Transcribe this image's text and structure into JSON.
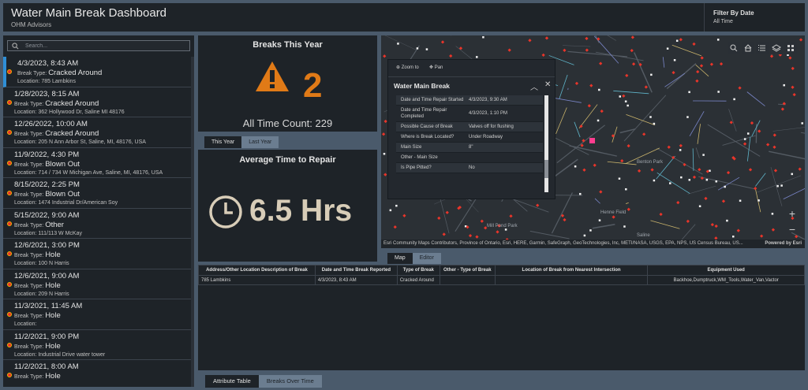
{
  "header": {
    "title": "Water Main Break Dashboard",
    "subtitle": "OHM Advisors",
    "filter_label": "Filter By Date",
    "filter_value": "All Time"
  },
  "search": {
    "placeholder": "Search..."
  },
  "breaks_list": [
    {
      "datetime": "4/3/2023, 8:43 AM",
      "type_label": "Break Type:",
      "type": "Cracked Around",
      "location": "Location: 785 Lambkins"
    },
    {
      "datetime": "1/28/2023, 8:15 AM",
      "type_label": "Break Type:",
      "type": "Cracked Around",
      "location": "Location: 362 Hollywood Dr, Saline MI 48176"
    },
    {
      "datetime": "12/26/2022, 10:00 AM",
      "type_label": "Break Type:",
      "type": "Cracked Around",
      "location": "Location: 205 N Ann Arbor St, Saline, MI, 48176, USA"
    },
    {
      "datetime": "11/9/2022, 4:30 PM",
      "type_label": "Break Type:",
      "type": "Blown Out",
      "location": "Location: 714 / 734 W Michigan Ave, Saline, MI, 48176, USA"
    },
    {
      "datetime": "8/15/2022, 2:25 PM",
      "type_label": "Break Type:",
      "type": "Blown Out",
      "location": "Location: 1474 Industrial Dr/American Soy"
    },
    {
      "datetime": "5/15/2022, 9:00 AM",
      "type_label": "Break Type:",
      "type": "Other",
      "location": "Location: 111/113 W McKay"
    },
    {
      "datetime": "12/6/2021, 3:00 PM",
      "type_label": "Break Type:",
      "type": "Hole",
      "location": "Location: 100 N Harris"
    },
    {
      "datetime": "12/6/2021, 9:00 AM",
      "type_label": "Break Type:",
      "type": "Hole",
      "location": "Location: 209 N Harris"
    },
    {
      "datetime": "11/3/2021, 11:45 AM",
      "type_label": "Break Type:",
      "type": "Hole",
      "location": "Location:"
    },
    {
      "datetime": "11/2/2021, 9:00 PM",
      "type_label": "Break Type:",
      "type": "Hole",
      "location": "Location: Industrial Drive water tower"
    },
    {
      "datetime": "11/2/2021, 8:00 AM",
      "type_label": "Break Type:",
      "type": "Hole",
      "location": ""
    }
  ],
  "breaks_card": {
    "title": "Breaks This Year",
    "value": "2",
    "all_time": "All Time Count: 229",
    "tab_this_year": "This Year",
    "tab_last_year": "Last Year"
  },
  "repair_card": {
    "title": "Average Time to Repair",
    "value": "6.5 Hrs"
  },
  "popup": {
    "zoom_to": "Zoom to",
    "pan": "Pan",
    "title": "Water Main Break",
    "rows": [
      {
        "key": "Date and Time Repair Started",
        "value": "4/3/2023, 9:30 AM"
      },
      {
        "key": "Date and Time Repair Completed",
        "value": "4/3/2023, 1:10 PM"
      },
      {
        "key": "Possible Cause of Break",
        "value": "Valves off for flushing"
      },
      {
        "key": "Where is Break Located?",
        "value": "Under Roadway"
      },
      {
        "key": "Main Size",
        "value": "8\""
      },
      {
        "key": "Other - Main Size",
        "value": ""
      },
      {
        "key": "Is Pipe Pitted?",
        "value": "No"
      }
    ]
  },
  "map": {
    "attribution": "Esri Community Maps Contributors, Province of Ontario, Esri, HERE, Garmin, SafeGraph, GeoTechnologies, Inc, METI/NASA, USGS, EPA, NPS, US Census Bureau, USDA, USFWS",
    "attribution_display": "Esri Community Maps Contributors, Province of Ontario, Esri, HERE, Garmin, SafeGraph, GeoTechnologies, Inc, METI/NASA, USGS, EPA, NPS, US Census Bureau, US...",
    "powered_by": "Powered by Esri",
    "labels": {
      "mill_pond": "Mill Pond Park",
      "saline": "Saline",
      "henne": "Henne Field",
      "benton": "Benton Park"
    },
    "tab_map": "Map",
    "tab_editor": "Editor",
    "zoom_in": "+",
    "zoom_out": "−"
  },
  "table": {
    "headers": [
      "Address/Other Location Description of Break",
      "Date and Time Break Reported",
      "Type of Break",
      "Other - Type of Break",
      "Location of Break from Nearest Intersection",
      "Equipment Used"
    ],
    "rows": [
      [
        "785 Lambkins",
        "4/3/2023, 8:43 AM",
        "Cracked Around",
        "",
        "",
        "Backhoe,Dumptruck,WM_Tools,Water_Van,Vactor"
      ]
    ],
    "tab_attribute": "Attribute Table",
    "tab_breaks_over_time": "Breaks Over Time"
  },
  "colors": {
    "accent_orange": "#e07a17",
    "break_marker": "#e9352a",
    "selected_bar": "#2f8fd6",
    "panel_bg": "#1e2328",
    "page_bg": "#4a5a6b"
  },
  "icons": [
    "search-icon",
    "warning-icon",
    "clock-icon",
    "zoom-to-icon",
    "pan-icon",
    "collapse-icon",
    "close-icon",
    "home-icon",
    "layer-list-icon",
    "layers-icon",
    "basemap-gallery-icon"
  ]
}
